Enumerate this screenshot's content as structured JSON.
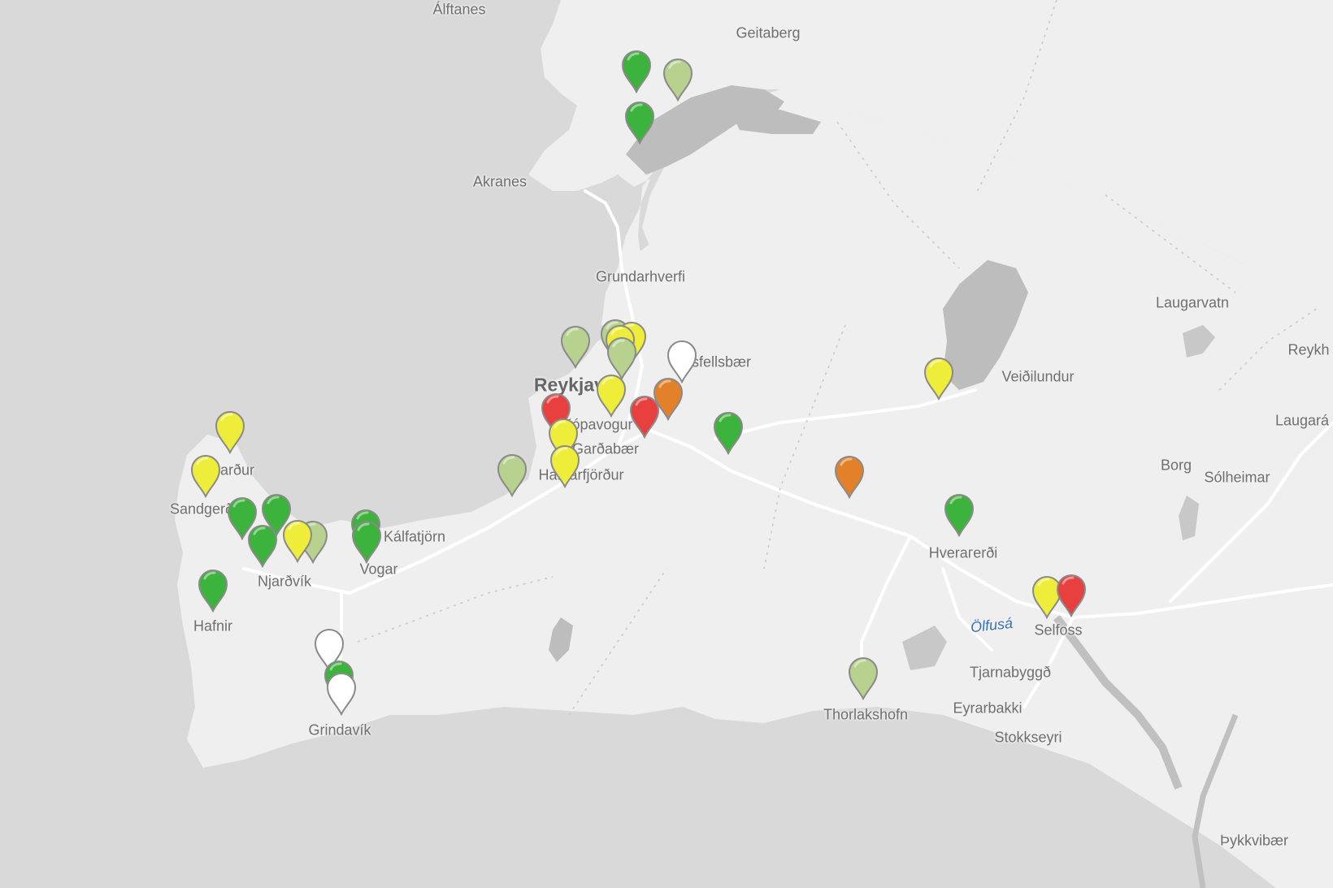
{
  "map": {
    "places": [
      {
        "name": "Álftanes",
        "cls": ""
      },
      {
        "name": "Geitaberg",
        "cls": ""
      },
      {
        "name": "Akranes",
        "cls": ""
      },
      {
        "name": "Grundarhverfi",
        "cls": ""
      },
      {
        "name": "Laugarvatn",
        "cls": ""
      },
      {
        "name": "Reykh",
        "cls": ""
      },
      {
        "name": "Veiðilundur",
        "cls": ""
      },
      {
        "name": "Laugará",
        "cls": ""
      },
      {
        "name": "Mosfellsbær",
        "cls": ""
      },
      {
        "name": "Reykjavík",
        "cls": "big"
      },
      {
        "name": "Kópavogur",
        "cls": ""
      },
      {
        "name": "Garðabær",
        "cls": ""
      },
      {
        "name": "Hafnarfjörður",
        "cls": ""
      },
      {
        "name": "Borg",
        "cls": ""
      },
      {
        "name": "Sólheimar",
        "cls": ""
      },
      {
        "name": "Garður",
        "cls": ""
      },
      {
        "name": "Sandgerði",
        "cls": ""
      },
      {
        "name": "Kálfatjörn",
        "cls": ""
      },
      {
        "name": "Vogar",
        "cls": ""
      },
      {
        "name": "Njarðvík",
        "cls": ""
      },
      {
        "name": "Hverагerði",
        "cls": ""
      },
      {
        "name": "Hafnir",
        "cls": ""
      },
      {
        "name": "Ölfusá",
        "cls": "water"
      },
      {
        "name": "Selfoss",
        "cls": ""
      },
      {
        "name": "Tjarnabyggð",
        "cls": ""
      },
      {
        "name": "Eyrarbakki",
        "cls": ""
      },
      {
        "name": "Thorlakshofn",
        "cls": ""
      },
      {
        "name": "Stokkseyri",
        "cls": ""
      },
      {
        "name": "Grindavík",
        "cls": ""
      },
      {
        "name": "Þykkvibær",
        "cls": ""
      }
    ],
    "markers": [
      {
        "color": "#3cb33c",
        "status": "green"
      },
      {
        "color": "#b6d28e",
        "status": "light-green"
      },
      {
        "color": "#3cb33c",
        "status": "green"
      },
      {
        "color": "#b6d28e",
        "status": "light-green"
      },
      {
        "color": "#b6d28e",
        "status": "light-green"
      },
      {
        "color": "#eeee3a",
        "status": "yellow"
      },
      {
        "color": "#eeee3a",
        "status": "yellow"
      },
      {
        "color": "#b6d28e",
        "status": "light-green"
      },
      {
        "color": "#ffffff",
        "status": "white"
      },
      {
        "color": "#eeee3a",
        "status": "yellow"
      },
      {
        "color": "#e2812a",
        "status": "orange"
      },
      {
        "color": "#e8403f",
        "status": "red"
      },
      {
        "color": "#e8403f",
        "status": "red"
      },
      {
        "color": "#eeee3a",
        "status": "yellow"
      },
      {
        "color": "#eeee3a",
        "status": "yellow"
      },
      {
        "color": "#3cb33c",
        "status": "green"
      },
      {
        "color": "#b6d28e",
        "status": "light-green"
      },
      {
        "color": "#eeee3a",
        "status": "yellow"
      },
      {
        "color": "#e2812a",
        "status": "orange"
      },
      {
        "color": "#3cb33c",
        "status": "green"
      },
      {
        "color": "#eeee3a",
        "status": "yellow"
      },
      {
        "color": "#e8403f",
        "status": "red"
      },
      {
        "color": "#b6d28e",
        "status": "light-green"
      },
      {
        "color": "#eeee3a",
        "status": "yellow"
      },
      {
        "color": "#eeee3a",
        "status": "yellow"
      },
      {
        "color": "#3cb33c",
        "status": "green"
      },
      {
        "color": "#3cb33c",
        "status": "green"
      },
      {
        "color": "#3cb33c",
        "status": "green"
      },
      {
        "color": "#b6d28e",
        "status": "light-green"
      },
      {
        "color": "#eeee3a",
        "status": "yellow"
      },
      {
        "color": "#3cb33c",
        "status": "green"
      },
      {
        "color": "#3cb33c",
        "status": "green"
      },
      {
        "color": "#3cb33c",
        "status": "green"
      },
      {
        "color": "#ffffff",
        "status": "white"
      },
      {
        "color": "#3cb33c",
        "status": "green"
      },
      {
        "color": "#ffffff",
        "status": "white"
      }
    ],
    "colors": {
      "sea": "#d9d9d9",
      "land": "#efefef",
      "lake": "#bdbdbd",
      "road": "#ffffff",
      "boundary": "#b5b5b5"
    }
  }
}
